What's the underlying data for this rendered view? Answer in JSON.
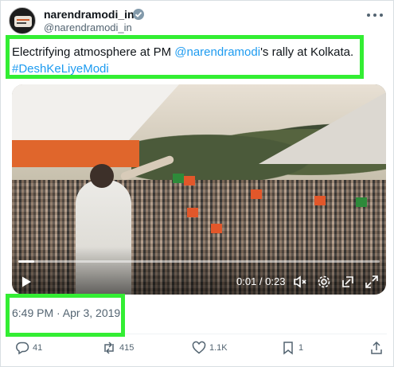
{
  "tweet": {
    "display_name": "narendramodi_in",
    "handle": "@narendramodi_in",
    "text_prefix": "Electrifying atmosphere at PM ",
    "mention": "@narendramodi",
    "text_suffix": "'s rally at Kolkata.",
    "hashtag": "#DeshKeLiyeModi",
    "timestamp": "6:49 PM · Apr 3, 2019"
  },
  "video": {
    "time_readout": "0:01 / 0:23",
    "progress": 0.043
  },
  "actions": {
    "replies": "41",
    "reposts": "415",
    "likes": "1.1K",
    "bookmarks": "1"
  },
  "colors": {
    "highlight": "#33ee33",
    "link": "#1d9bf0",
    "muted": "#536471"
  }
}
